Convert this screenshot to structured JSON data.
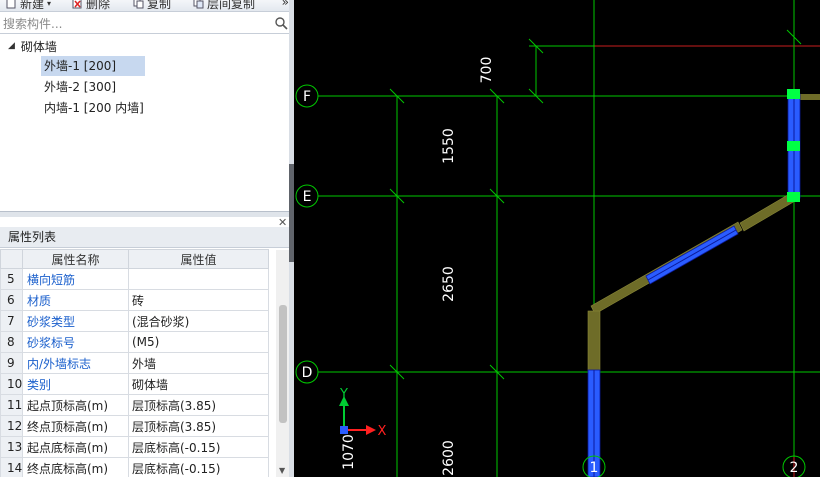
{
  "toolbar": {
    "new_label": "新建",
    "delete_label": "删除",
    "copy_label": "复制",
    "floor_copy_label": "层间复制",
    "more_label": "»"
  },
  "search": {
    "placeholder": "搜索构件..."
  },
  "tree": {
    "root_label": "砌体墙",
    "items": [
      {
        "label": "外墙-1 [200]",
        "selected": true
      },
      {
        "label": "外墙-2 [300]",
        "selected": false
      },
      {
        "label": "内墙-1 [200 内墙]",
        "selected": false
      }
    ]
  },
  "properties": {
    "title": "属性列表",
    "col_name": "属性名称",
    "col_value": "属性值",
    "rows": [
      {
        "num": "5",
        "name": "横向短筋",
        "value": "",
        "blue": true
      },
      {
        "num": "6",
        "name": "材质",
        "value": "砖",
        "blue": true
      },
      {
        "num": "7",
        "name": "砂浆类型",
        "value": "(混合砂浆)",
        "blue": true
      },
      {
        "num": "8",
        "name": "砂浆标号",
        "value": "(M5)",
        "blue": true
      },
      {
        "num": "9",
        "name": "内/外墙标志",
        "value": "外墙",
        "blue": true
      },
      {
        "num": "10",
        "name": "类别",
        "value": "砌体墙",
        "blue": true
      },
      {
        "num": "11",
        "name": "起点顶标高(m)",
        "value": "层顶标高(3.85)",
        "blue": false
      },
      {
        "num": "12",
        "name": "终点顶标高(m)",
        "value": "层顶标高(3.85)",
        "blue": false
      },
      {
        "num": "13",
        "name": "起点底标高(m)",
        "value": "层底标高(-0.15)",
        "blue": false
      },
      {
        "num": "14",
        "name": "终点底标高(m)",
        "value": "层底标高(-0.15)",
        "blue": false
      }
    ]
  },
  "drawing": {
    "axis_labels": {
      "F": "F",
      "E": "E",
      "D": "D",
      "one": "1",
      "two": "2"
    },
    "dimensions": {
      "d700": "700",
      "d1550": "1550",
      "d2650": "2650",
      "d2600": "2600",
      "d1070": "1070"
    },
    "ucs": {
      "x": "X",
      "y": "Y"
    },
    "colors": {
      "grid_green": "#00c800",
      "red_line": "#c81e1e",
      "wall_olive": "#6e6c28",
      "wall_blue": "#2a5cff",
      "node_green": "#00ff44"
    }
  }
}
